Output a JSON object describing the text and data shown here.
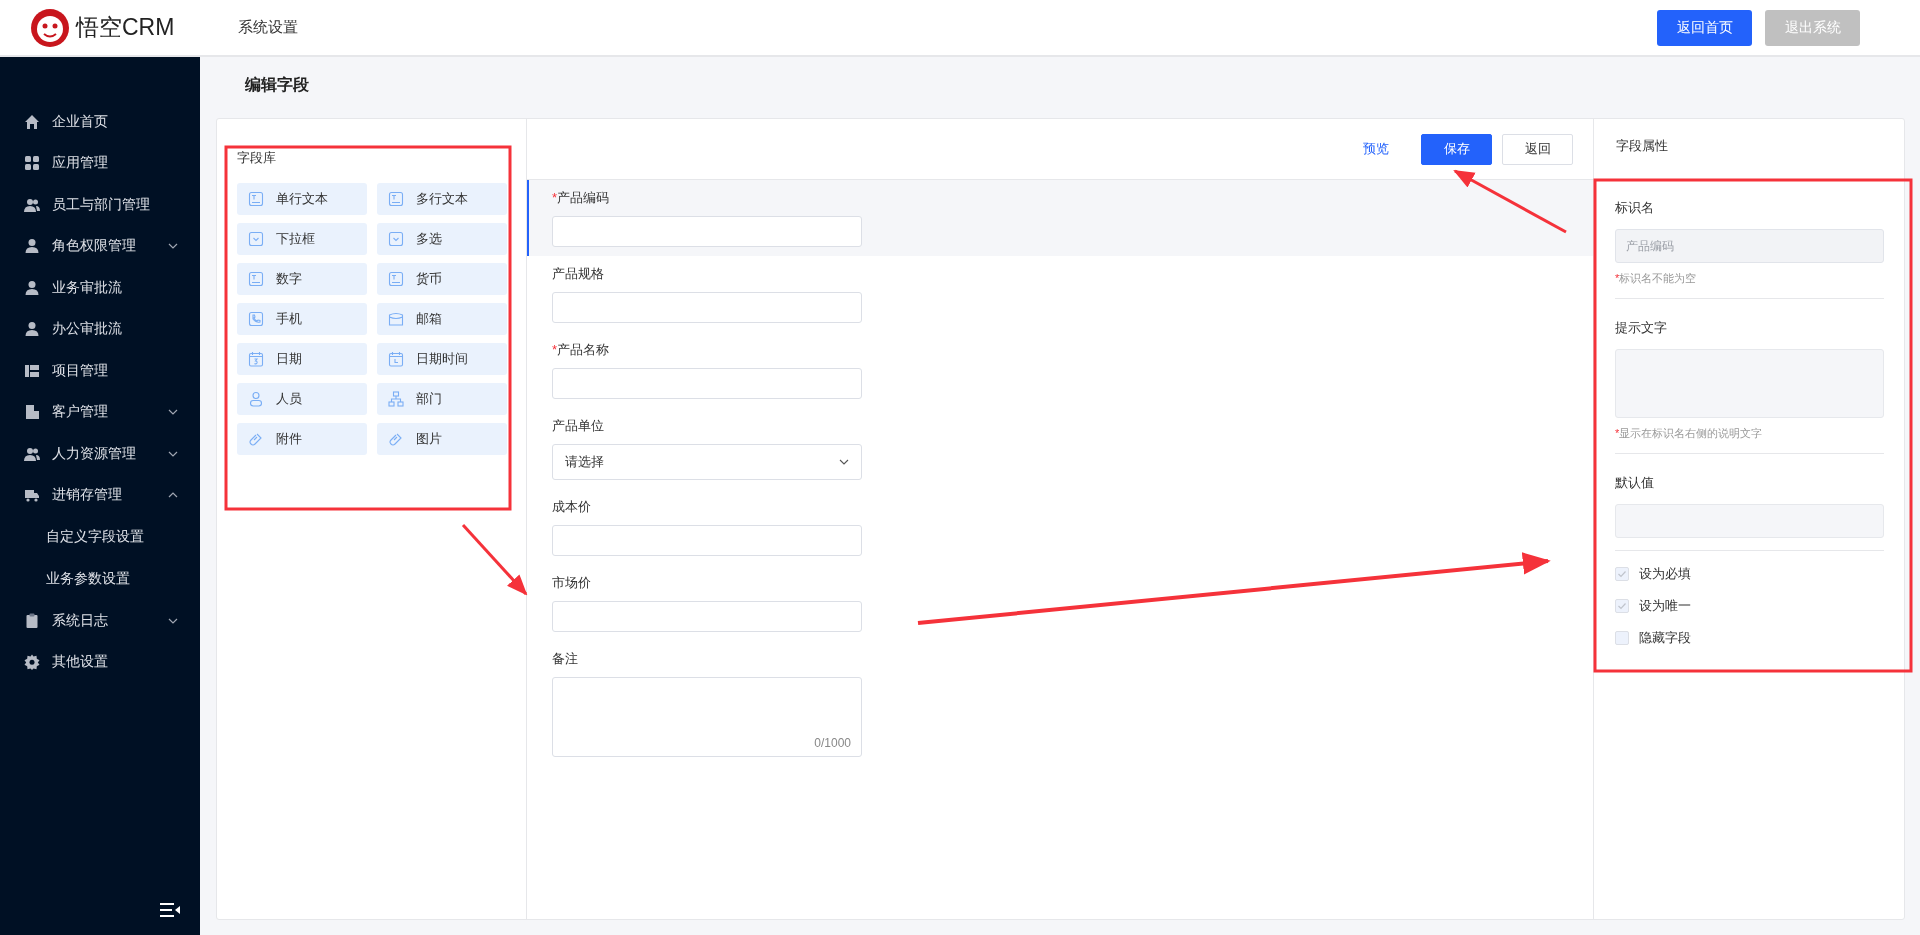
{
  "header": {
    "logo_text": "悟空CRM",
    "section": "系统设置",
    "buttons": [
      {
        "label": "返回首页",
        "kind": "primary"
      },
      {
        "label": "退出系统",
        "kind": "disabled"
      }
    ]
  },
  "sidebar": {
    "items": [
      {
        "label": "企业首页",
        "kind": "link"
      },
      {
        "label": "应用管理",
        "kind": "link"
      },
      {
        "label": "员工与部门管理",
        "kind": "link"
      },
      {
        "label": "角色权限管理",
        "kind": "group",
        "expanded": false
      },
      {
        "label": "业务审批流",
        "kind": "link"
      },
      {
        "label": "办公审批流",
        "kind": "link"
      },
      {
        "label": "项目管理",
        "kind": "link"
      },
      {
        "label": "客户管理",
        "kind": "group",
        "expanded": false
      },
      {
        "label": "人力资源管理",
        "kind": "group",
        "expanded": false
      },
      {
        "label": "进销存管理",
        "kind": "group",
        "expanded": true,
        "children": [
          {
            "label": "自定义字段设置"
          },
          {
            "label": "业务参数设置"
          }
        ]
      },
      {
        "label": "系统日志",
        "kind": "group",
        "expanded": false
      },
      {
        "label": "其他设置",
        "kind": "link"
      }
    ]
  },
  "page_title": "编辑字段",
  "field_library": {
    "title": "字段库",
    "items": [
      "单行文本",
      "多行文本",
      "下拉框",
      "多选",
      "数字",
      "货币",
      "手机",
      "邮箱",
      "日期",
      "日期时间",
      "人员",
      "部门",
      "附件",
      "图片"
    ]
  },
  "toolbar": {
    "preview": "预览",
    "save": "保存",
    "back": "返回"
  },
  "form": {
    "required_mark": "*",
    "fields": [
      {
        "label": "产品编码",
        "required": true,
        "kind": "input",
        "selected": true
      },
      {
        "label": "产品规格",
        "required": false,
        "kind": "input",
        "selected": false
      },
      {
        "label": "产品名称",
        "required": true,
        "kind": "input",
        "selected": false
      },
      {
        "label": "产品单位",
        "required": false,
        "kind": "select",
        "selected": false,
        "placeholder": "请选择"
      },
      {
        "label": "成本价",
        "required": false,
        "kind": "input",
        "selected": false
      },
      {
        "label": "市场价",
        "required": false,
        "kind": "input",
        "selected": false
      },
      {
        "label": "备注",
        "required": false,
        "kind": "textarea",
        "selected": false,
        "counter": "0/1000"
      }
    ]
  },
  "properties": {
    "title": "字段属性",
    "required_mark": "*",
    "sections": [
      {
        "label": "标识名",
        "kind": "input",
        "value": "产品编码",
        "disabled": true,
        "hint": "标识名不能为空"
      },
      {
        "label": "提示文字",
        "kind": "textarea",
        "hint": "显示在标识名右侧的说明文字"
      },
      {
        "label": "默认值",
        "kind": "input"
      }
    ],
    "checkboxes": [
      {
        "label": "设为必填",
        "checked": true,
        "disabled": true
      },
      {
        "label": "设为唯一",
        "checked": true,
        "disabled": true
      },
      {
        "label": "隐藏字段",
        "checked": false,
        "disabled": true
      }
    ]
  }
}
